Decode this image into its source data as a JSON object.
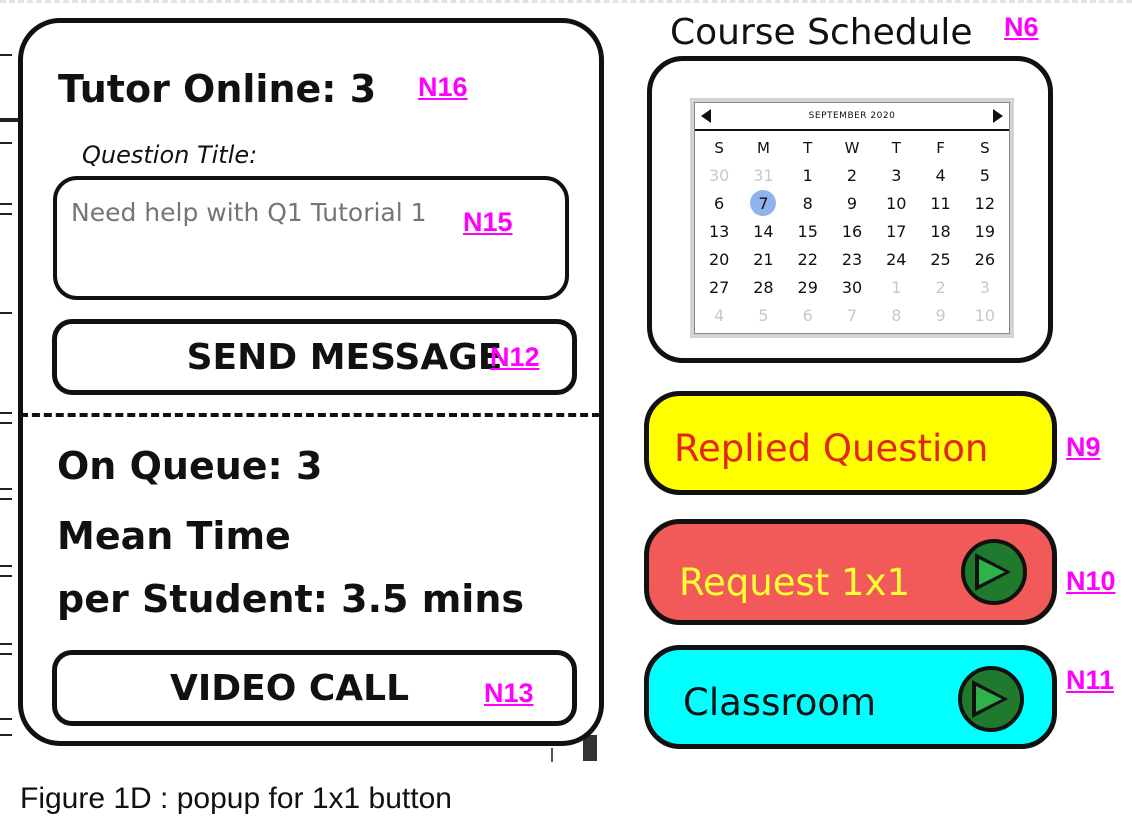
{
  "annotations": {
    "n16": "N16",
    "n15": "N15",
    "n12": "N12",
    "n13": "N13",
    "n6": "N6",
    "n9": "N9",
    "n10": "N10",
    "n11": "N11"
  },
  "tutor_panel": {
    "tutor_online": "Tutor Online: 3",
    "question_title_label": "Question Title:",
    "question_placeholder": "Need help with Q1 Tutorial 1",
    "send_message_label": "SEND MESSAGE",
    "on_queue": "On Queue: 3",
    "mean_time_line1": "Mean Time",
    "mean_time_line2": "per Student: 3.5 mins",
    "video_call_label": "VIDEO CALL"
  },
  "schedule": {
    "title": "Course Schedule",
    "month": "SEPTEMBER 2020",
    "weekdays": [
      "S",
      "M",
      "T",
      "W",
      "T",
      "F",
      "S"
    ],
    "weeks": [
      [
        "30",
        "31",
        "1",
        "2",
        "3",
        "4",
        "5"
      ],
      [
        "6",
        "7",
        "8",
        "9",
        "10",
        "11",
        "12"
      ],
      [
        "13",
        "14",
        "15",
        "16",
        "17",
        "18",
        "19"
      ],
      [
        "20",
        "21",
        "22",
        "23",
        "24",
        "25",
        "26"
      ],
      [
        "27",
        "28",
        "29",
        "30",
        "1",
        "2",
        "3"
      ],
      [
        "4",
        "5",
        "6",
        "7",
        "8",
        "9",
        "10"
      ]
    ],
    "selected_day": "7"
  },
  "actions": {
    "replied_question": "Replied Question",
    "request_1x1": "Request 1x1",
    "classroom": "Classroom"
  },
  "colors": {
    "replied_bg": "#ffff00",
    "replied_text": "#e2261a",
    "request_bg": "#f25a5a",
    "request_text": "#ffff33",
    "classroom_bg": "#00ffff",
    "play_icon": "#1f7a2e",
    "annotation": "#ff00ff"
  },
  "caption": "Figure 1D : popup for 1x1 button"
}
